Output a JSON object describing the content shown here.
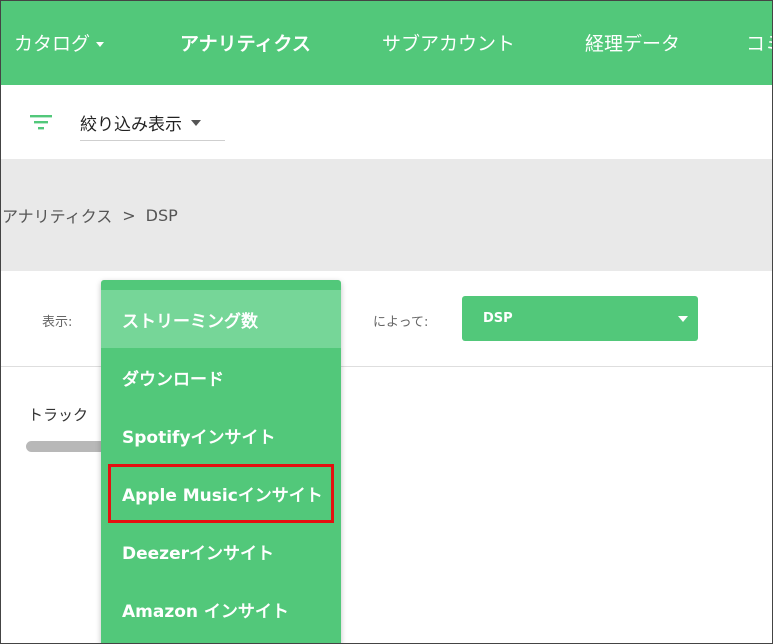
{
  "nav": {
    "items": [
      {
        "label": "カタログ",
        "has_caret": true
      },
      {
        "label": "アナリティクス",
        "bold": true
      },
      {
        "label": "サブアカウント"
      },
      {
        "label": "経理データ"
      },
      {
        "label": "コミ"
      }
    ]
  },
  "filter": {
    "icon": "filter-icon",
    "label": "絞り込み表示"
  },
  "breadcrumb": {
    "items": [
      "アナリティクス",
      "DSP"
    ],
    "separator": ">"
  },
  "controls": {
    "show_label": "表示:",
    "by_label": "によって:",
    "dsp_value": "DSP"
  },
  "track": {
    "label": "トラック"
  },
  "menu": {
    "items": [
      "ストリーミング数",
      "ダウンロード",
      "Spotifyインサイト",
      "Apple Musicインサイト",
      "Deezerインサイト",
      "Amazon インサイト"
    ],
    "active_index": 0,
    "highlighted_index": 3
  },
  "colors": {
    "brand": "#52c87a",
    "menu_active": "#76d698",
    "band": "#e9e9e9",
    "highlight": "#e41010"
  }
}
